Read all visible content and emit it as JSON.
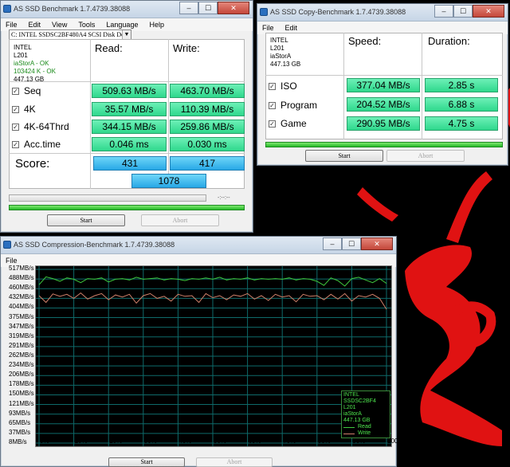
{
  "main_window": {
    "title": "AS SSD Benchmark 1.7.4739.38088",
    "menu": [
      "File",
      "Edit",
      "View",
      "Tools",
      "Language",
      "Help"
    ],
    "drive_select": "C: INTEL SSDSC2BF480A4 SCSI Disk Devic",
    "drive_info": {
      "model": "INTEL",
      "firmware": "L201",
      "driver": "iaStorA - OK",
      "alignment": "103424 K - OK",
      "capacity": "447.13 GB"
    },
    "col_read": "Read:",
    "col_write": "Write:",
    "rows": [
      {
        "label": "Seq",
        "read": "509.63 MB/s",
        "write": "463.70 MB/s"
      },
      {
        "label": "4K",
        "read": "35.57 MB/s",
        "write": "110.39 MB/s"
      },
      {
        "label": "4K-64Thrd",
        "read": "344.15 MB/s",
        "write": "259.86 MB/s"
      },
      {
        "label": "Acc.time",
        "read": "0.046 ms",
        "write": "0.030 ms"
      }
    ],
    "score_label": "Score:",
    "score_read": "431",
    "score_write": "417",
    "score_total": "1078",
    "timer": "-:--:--",
    "start_label": "Start",
    "abort_label": "Abort"
  },
  "copy_window": {
    "title": "AS SSD Copy-Benchmark 1.7.4739.38088",
    "menu": [
      "File",
      "Edit"
    ],
    "info": {
      "model": "INTEL",
      "firmware": "L201",
      "driver": "iaStorA",
      "capacity": "447.13 GB"
    },
    "col_speed": "Speed:",
    "col_duration": "Duration:",
    "rows": [
      {
        "label": "ISO",
        "speed": "377.04 MB/s",
        "duration": "2.85 s"
      },
      {
        "label": "Program",
        "speed": "204.52 MB/s",
        "duration": "6.88 s"
      },
      {
        "label": "Game",
        "speed": "290.95 MB/s",
        "duration": "4.75 s"
      }
    ],
    "start_label": "Start",
    "abort_label": "Abort"
  },
  "compression_window": {
    "title": "AS SSD Compression-Benchmark 1.7.4739.38088",
    "menu": [
      "File"
    ],
    "legend": {
      "model": "INTEL SSDSC2BF4",
      "firmware": "L201",
      "driver": "iaStorA",
      "capacity": "447.13 GB",
      "read_label": "Read",
      "write_label": "Write"
    },
    "start_label": "Start",
    "abort_label": "Abort"
  },
  "colors": {
    "read_line": "#3ec83e",
    "write_line": "#d0806a",
    "accent_green": "#2fd88c",
    "accent_blue": "#28a8e6"
  },
  "chart_data": {
    "type": "line",
    "ytick_labels": [
      "517MB/s",
      "488MB/s",
      "460MB/s",
      "432MB/s",
      "404MB/s",
      "375MB/s",
      "347MB/s",
      "319MB/s",
      "291MB/s",
      "262MB/s",
      "234MB/s",
      "206MB/s",
      "178MB/s",
      "150MB/s",
      "121MB/s",
      "93MB/s",
      "65MB/s",
      "37MB/s",
      "8MB/s"
    ],
    "xtick_labels": [
      "0%",
      "10%",
      "20%",
      "30%",
      "40%",
      "50%",
      "60%",
      "70%",
      "80%",
      "90%",
      "100%"
    ],
    "ylim": [
      8,
      517
    ],
    "grid": true,
    "x": [
      0,
      2,
      4,
      6,
      8,
      10,
      12,
      14,
      16,
      18,
      20,
      22,
      24,
      26,
      28,
      30,
      32,
      34,
      36,
      38,
      40,
      42,
      44,
      46,
      48,
      50,
      52,
      54,
      56,
      58,
      60,
      62,
      64,
      66,
      68,
      70,
      72,
      74,
      76,
      78,
      80,
      82,
      84,
      86,
      88,
      90,
      92,
      94,
      96,
      98,
      100
    ],
    "series": [
      {
        "name": "Read",
        "values": [
          472,
          495,
          490,
          482,
          492,
          488,
          478,
          490,
          488,
          492,
          480,
          488,
          490,
          486,
          494,
          488,
          490,
          492,
          486,
          490,
          488,
          484,
          490,
          488,
          492,
          488,
          494,
          486,
          490,
          488,
          492,
          486,
          490,
          488,
          490,
          488,
          492,
          486,
          490,
          488,
          482,
          470,
          492,
          484,
          468,
          490,
          494,
          486,
          478,
          490,
          476
        ]
      },
      {
        "name": "Write",
        "values": [
          440,
          420,
          445,
          438,
          444,
          432,
          448,
          430,
          440,
          446,
          428,
          442,
          436,
          444,
          418,
          440,
          446,
          432,
          438,
          424,
          444,
          438,
          440,
          420,
          446,
          434,
          440,
          428,
          442,
          438,
          446,
          430,
          440,
          426,
          444,
          436,
          440,
          422,
          444,
          438,
          440,
          428,
          444,
          430,
          446,
          424,
          440,
          436,
          444,
          432,
          400
        ]
      }
    ]
  }
}
